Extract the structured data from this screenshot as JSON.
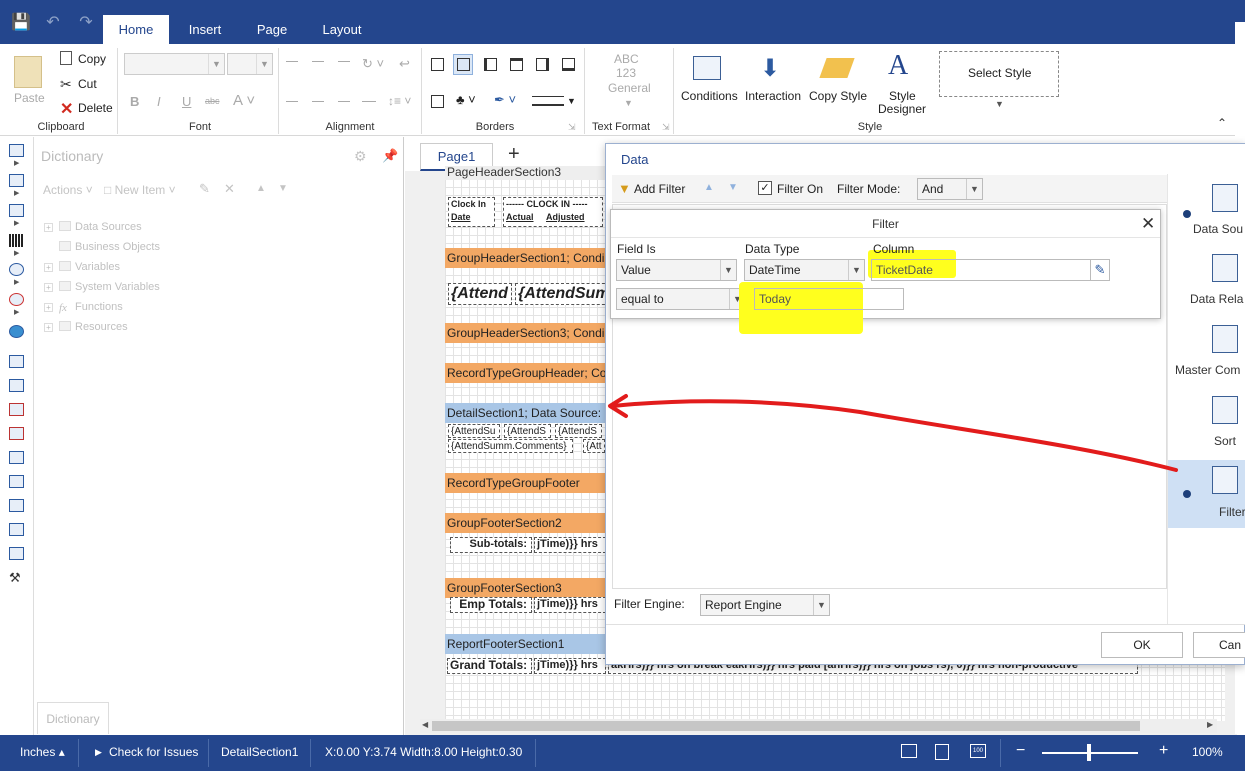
{
  "ribbon": {
    "tabs": [
      "Home",
      "Insert",
      "Page",
      "Layout"
    ],
    "clipboard": {
      "paste": "Paste",
      "copy": "Copy",
      "cut": "Cut",
      "delete": "Delete",
      "label": "Clipboard"
    },
    "font": {
      "label": "Font"
    },
    "alignment": {
      "label": "Alignment"
    },
    "borders": {
      "label": "Borders"
    },
    "text_format": {
      "abc": "ABC",
      "num": "123",
      "general": "General",
      "label": "Text Format"
    },
    "style": {
      "conditions": "Conditions",
      "interaction": "Interaction",
      "copy_style": "Copy Style",
      "style_designer_1": "Style",
      "style_designer_2": "Designer",
      "select_style": "Select Style",
      "label": "Style"
    }
  },
  "dictionary": {
    "title": "Dictionary",
    "actions": "Actions",
    "new_item": "New Item",
    "tree": [
      "Data Sources",
      "Business Objects",
      "Variables",
      "System Variables",
      "Functions",
      "Resources"
    ],
    "tab": "Dictionary"
  },
  "design": {
    "page_tab": "Page1",
    "bands": {
      "page_header": "PageHeaderSection3",
      "gh1": "GroupHeaderSection1; Condi",
      "gh3": "GroupHeaderSection3; Condi",
      "rt_header": "RecordTypeGroupHeader; Co",
      "detail": "DetailSection1; Data Source:",
      "rt_footer": "RecordTypeGroupFooter",
      "gf2": "GroupFooterSection2",
      "gf3": "GroupFooterSection3",
      "report_footer": "ReportFooterSection1"
    },
    "fields": {
      "clock_in": "Clock In",
      "date": "Date",
      "clock_in_hdr": "------ CLOCK IN -----",
      "actual": "Actual",
      "adjusted": "Adjusted",
      "attend1": "{Attend",
      "attend_sum": "{AttendSum",
      "d1": "{AttendSu",
      "d2": "{AttendS",
      "d3": "{AttendS",
      "comments": "{AttendSumm.Comments}",
      "att": "{Att",
      "subtotals": "Sub-totals:",
      "subtime": "jTime)}} hrs",
      "emp_totals": "Emp Totals:",
      "emptime": "jTime)}} hrs",
      "grand_totals": "Grand Totals:",
      "grandtime": "jTime)}} hrs",
      "grand_tail": "akHrs)}} hrs on break  eakHrs)}} hrs paid  [anHrs)}} hrs on jobs  rs), 0)}} hrs non-productive"
    }
  },
  "data_dialog": {
    "title": "Data",
    "add_filter": "Add Filter",
    "filter_on": "Filter On",
    "filter_mode_label": "Filter Mode:",
    "filter_mode": "And",
    "filter_engine_label": "Filter Engine:",
    "filter_engine": "Report Engine",
    "ok": "OK",
    "cancel": "Can",
    "nav": [
      "Data Sou",
      "Data Rela",
      "Master Com",
      "Sort",
      "Filters"
    ]
  },
  "filter_dialog": {
    "title": "Filter",
    "field_is_label": "Field Is",
    "field_is": "Value",
    "data_type_label": "Data Type",
    "data_type": "DateTime",
    "column_label": "Column",
    "column": "TicketDate",
    "condition": "equal to",
    "value": "Today"
  },
  "status": {
    "units": "Inches",
    "check": "Check for Issues",
    "component": "DetailSection1",
    "geometry": "X:0.00 Y:3.74 Width:8.00 Height:0.30",
    "zoom": "100%"
  },
  "colors": {
    "brand": "#24468d",
    "band_orange": "#f3a864",
    "band_blue": "#a9c6e6",
    "highlight": "#ffff1e",
    "arrow": "#e21c1c"
  }
}
